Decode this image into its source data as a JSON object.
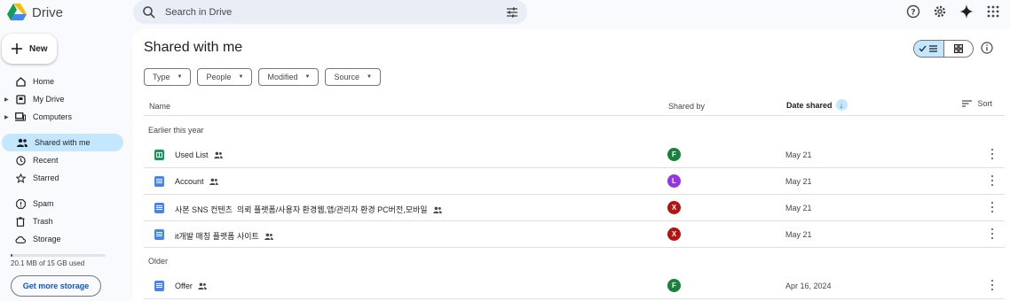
{
  "app": {
    "name": "Drive"
  },
  "search": {
    "placeholder": "Search in Drive"
  },
  "sidebar": {
    "new_label": "New",
    "items": [
      {
        "label": "Home",
        "icon": "home-icon",
        "expandable": false
      },
      {
        "label": "My Drive",
        "icon": "drive-icon",
        "expandable": true
      },
      {
        "label": "Computers",
        "icon": "computers-icon",
        "expandable": true
      },
      {
        "label": "Shared with me",
        "icon": "shared-icon",
        "expandable": false,
        "active": true
      },
      {
        "label": "Recent",
        "icon": "clock-icon",
        "expandable": false
      },
      {
        "label": "Starred",
        "icon": "star-icon",
        "expandable": false
      },
      {
        "label": "Spam",
        "icon": "spam-icon",
        "expandable": false
      },
      {
        "label": "Trash",
        "icon": "trash-icon",
        "expandable": false
      },
      {
        "label": "Storage",
        "icon": "cloud-icon",
        "expandable": false
      }
    ],
    "storage": {
      "used_text": "20.1 MB of 15 GB used",
      "used_fraction": 0.0013,
      "button_label": "Get more storage"
    }
  },
  "main": {
    "title": "Shared with me",
    "filters": [
      "Type",
      "People",
      "Modified",
      "Source"
    ],
    "columns": {
      "name": "Name",
      "shared_by": "Shared by",
      "date_shared": "Date shared",
      "sort": "Sort"
    },
    "sections": [
      {
        "label": "Earlier this year",
        "files": [
          {
            "name": "Used List",
            "type": "sheet",
            "avatar_letter": "F",
            "avatar_color": "#188038",
            "date": "May 21"
          },
          {
            "name": "Account",
            "type": "doc",
            "avatar_letter": "L",
            "avatar_color": "#9334e6",
            "date": "May 21"
          },
          {
            "name": "사본 SNS 컨텐츠  의뢰 플랫폼/사용자 환경웹,앱/관리자 환경 PC버전,모바일",
            "type": "doc",
            "avatar_letter": "X",
            "avatar_color": "#b31412",
            "date": "May 21"
          },
          {
            "name": "it개발 매칭 플랫폼 사이트",
            "type": "doc",
            "avatar_letter": "X",
            "avatar_color": "#b31412",
            "date": "May 21"
          }
        ]
      },
      {
        "label": "Older",
        "files": [
          {
            "name": "Offer",
            "type": "doc",
            "avatar_letter": "F",
            "avatar_color": "#188038",
            "date": "Apr 16, 2024"
          }
        ]
      }
    ]
  },
  "colors": {
    "accent": "#0b57d0",
    "active_bg": "#c2e7ff",
    "page_bg": "#f8fafd"
  }
}
